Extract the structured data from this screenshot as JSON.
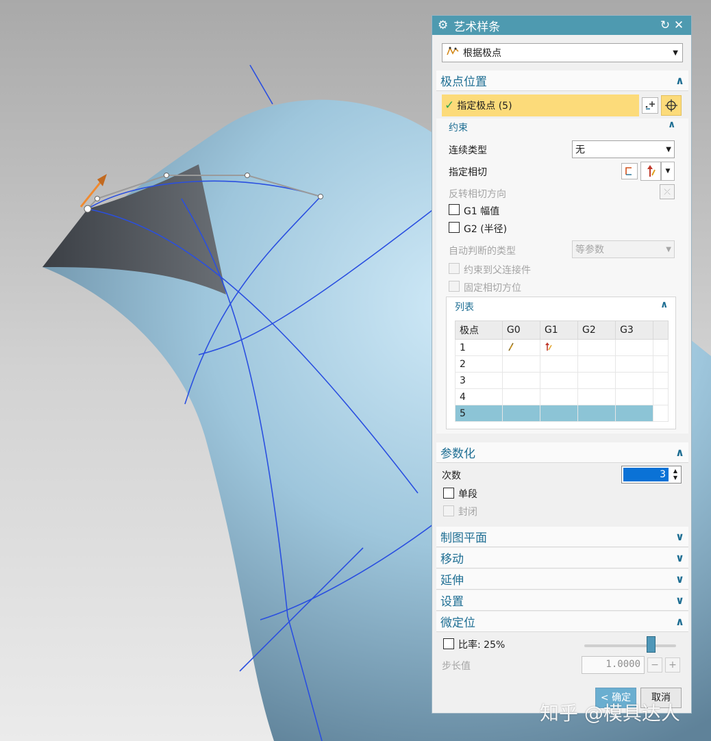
{
  "dialog": {
    "title": "艺术样条",
    "type_select": "根据极点",
    "sections": {
      "pole_position": "极点位置",
      "parameterize": "参数化",
      "drawing_plane": "制图平面",
      "move": "移动",
      "extend": "延伸",
      "settings": "设置",
      "fine_position": "微定位"
    },
    "pole_row": "指定极点 (5)",
    "constraint": {
      "title": "约束",
      "continuity_label": "连续类型",
      "continuity_value": "无",
      "tangent_label": "指定相切",
      "reverse_tangent": "反转相切方向",
      "g1_amplitude": "G1 幅值",
      "g2_radius": "G2 (半径)",
      "auto_type_label": "自动判断的类型",
      "auto_type_value": "等参数",
      "constrain_parent": "约束到父连接件",
      "fix_tangent": "固定相切方位"
    },
    "list": {
      "title": "列表",
      "headers": [
        "极点",
        "G0",
        "G1",
        "G2",
        "G3"
      ],
      "rows": [
        "1",
        "2",
        "3",
        "4",
        "5"
      ]
    },
    "parameterize": {
      "degree_label": "次数",
      "degree_value": "3",
      "single_segment": "单段",
      "closed": "封闭"
    },
    "fine_position": {
      "ratio_label": "比率:",
      "ratio_value": "25%",
      "step_label": "步长值",
      "step_value": "1.0000"
    },
    "buttons": {
      "ok": "< 确定 >",
      "cancel": "取消"
    }
  },
  "watermark": "知乎 @模具达人",
  "colors": {
    "title_bar": "#4e9ab0",
    "highlight": "#fcdb7a",
    "selected_row": "#8cc4d6",
    "section_text": "#1e6e93",
    "curve": "#2a4fe0"
  }
}
